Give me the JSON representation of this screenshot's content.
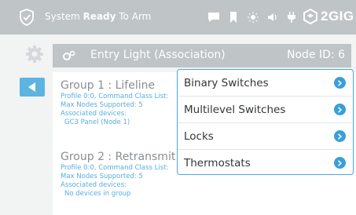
{
  "status_bar": {
    "prefix": "System",
    "ready": "Ready",
    "suffix": "To Arm",
    "brand": "2GIG",
    "icons": [
      "shield-icon",
      "chat-icon",
      "bookmark-icon",
      "brightness-icon",
      "volume-icon",
      "power-plug-icon",
      "brand-logo-icon"
    ]
  },
  "header": {
    "title": "Entry Light (Association)",
    "node_id": "Node ID: 6",
    "icon": "device-gears-icon"
  },
  "nav": {
    "settings_icon": "gear-icon",
    "back_icon": "back-arrow-icon"
  },
  "groups": [
    {
      "title": "Group 1 : Lifeline",
      "profile": "Profile 0:0, Command Class List:",
      "max_nodes": "Max Nodes Supported: 5",
      "associated_label": "Associated devices:",
      "devices": "GC3 Panel (Node 1)"
    },
    {
      "title": "Group 2 : Retransmit",
      "profile": "Profile 0:0, Command Class List:",
      "max_nodes": "Max Nodes Supported: 5",
      "associated_label": "Associated devices:",
      "devices": "No devices in group"
    }
  ],
  "menu": {
    "items": [
      {
        "label": "Binary Switches"
      },
      {
        "label": "Multilevel Switches"
      },
      {
        "label": "Locks"
      },
      {
        "label": "Thermostats"
      }
    ]
  },
  "colors": {
    "accent": "#3a9fd8",
    "bar_gray": "#bfc4c6",
    "link_blue": "#58aee0"
  }
}
